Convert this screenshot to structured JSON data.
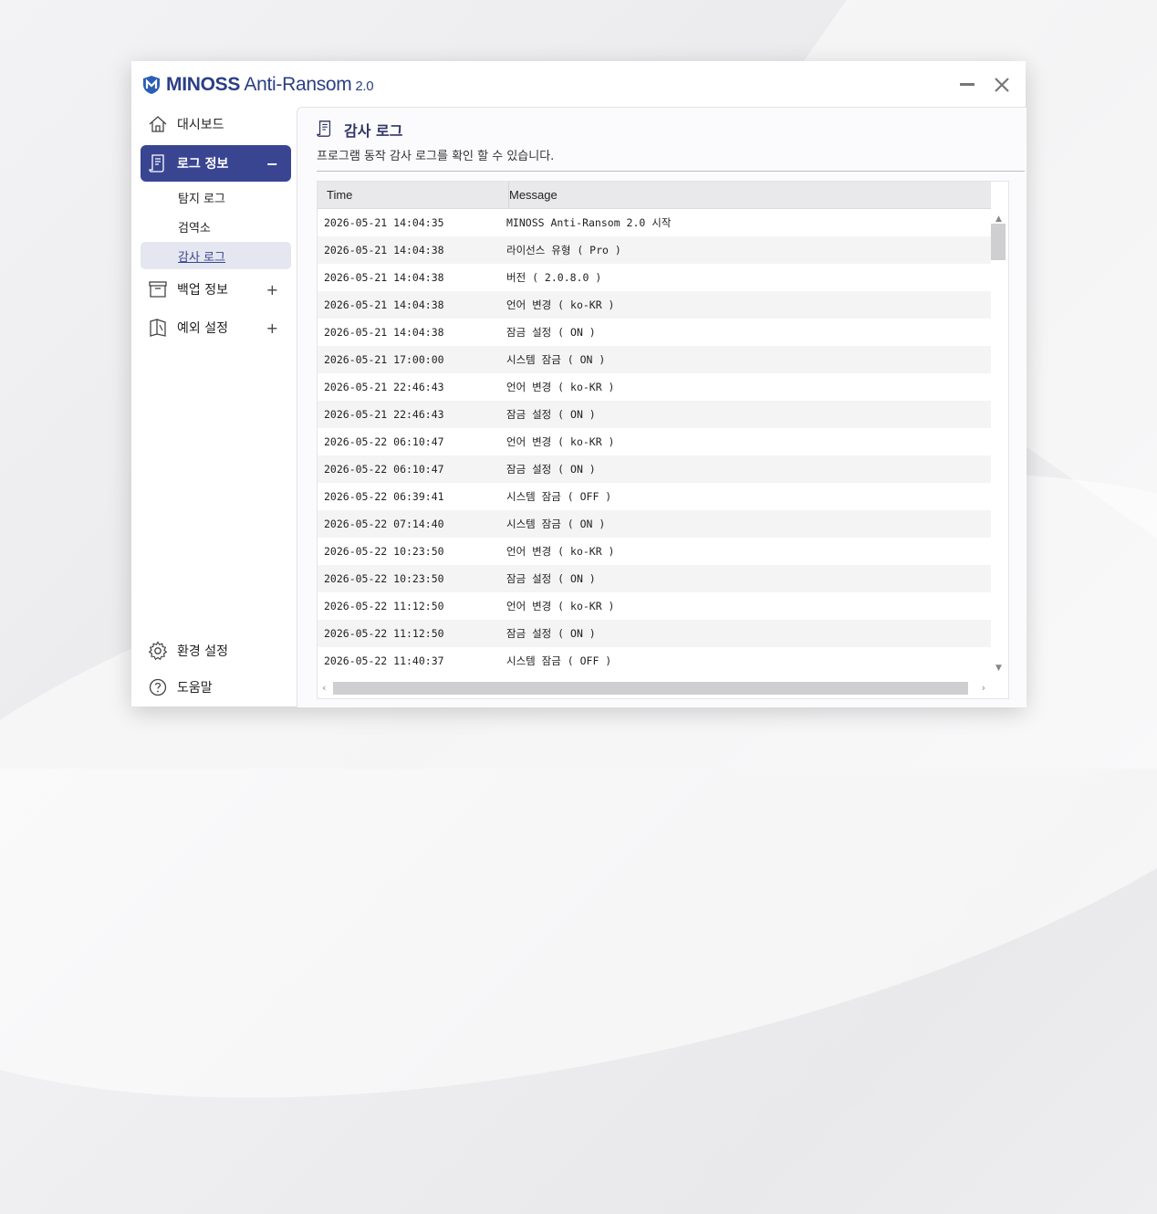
{
  "app": {
    "brand": "MINOSS",
    "name": " Anti-Ransom",
    "version": " 2.0"
  },
  "sidebar": {
    "dashboard": "대시보드",
    "log_info": "로그 정보",
    "log_info_toggle": "−",
    "sub_items": [
      "탐지 로그",
      "검역소",
      "감사 로그"
    ],
    "backup_info": "백업 정보",
    "backup_toggle": "+",
    "exception": "예외 설정",
    "exception_toggle": "+",
    "settings": "환경 설정",
    "help": "도움말"
  },
  "page": {
    "title": "감사 로그",
    "description": "프로그램 동작 감사 로그를 확인 할 수 있습니다."
  },
  "table": {
    "columns": [
      "Time",
      "Message"
    ],
    "rows": [
      [
        "2026-05-21 14:04:35",
        "MINOSS Anti-Ransom 2.0 시작"
      ],
      [
        "2026-05-21 14:04:38",
        "라이선스 유형 ( Pro )"
      ],
      [
        "2026-05-21 14:04:38",
        "버전 ( 2.0.8.0 )"
      ],
      [
        "2026-05-21 14:04:38",
        "언어 변경 ( ko-KR )"
      ],
      [
        "2026-05-21 14:04:38",
        "잠금 설정 ( ON )"
      ],
      [
        "2026-05-21 17:00:00",
        "시스템 잠금 ( ON )"
      ],
      [
        "2026-05-21 22:46:43",
        "언어 변경 ( ko-KR )"
      ],
      [
        "2026-05-21 22:46:43",
        "잠금 설정 ( ON )"
      ],
      [
        "2026-05-22 06:10:47",
        "언어 변경 ( ko-KR )"
      ],
      [
        "2026-05-22 06:10:47",
        "잠금 설정 ( ON )"
      ],
      [
        "2026-05-22 06:39:41",
        "시스템 잠금 ( OFF )"
      ],
      [
        "2026-05-22 07:14:40",
        "시스템 잠금 ( ON )"
      ],
      [
        "2026-05-22 10:23:50",
        "언어 변경 ( ko-KR )"
      ],
      [
        "2026-05-22 10:23:50",
        "잠금 설정 ( ON )"
      ],
      [
        "2026-05-22 11:12:50",
        "언어 변경 ( ko-KR )"
      ],
      [
        "2026-05-22 11:12:50",
        "잠금 설정 ( ON )"
      ],
      [
        "2026-05-22 11:40:37",
        "시스템 잠금 ( OFF )"
      ]
    ]
  },
  "icons": {
    "logo": "shield-m-icon",
    "minimize": "minimize-icon",
    "close": "close-icon",
    "dashboard": "home-icon",
    "log_info": "document-icon",
    "backup": "archive-box-icon",
    "exception": "book-icon",
    "settings": "gear-icon",
    "help": "question-circle-icon"
  },
  "colors": {
    "accent": "#3a4592",
    "brand": "#2b3f86"
  }
}
